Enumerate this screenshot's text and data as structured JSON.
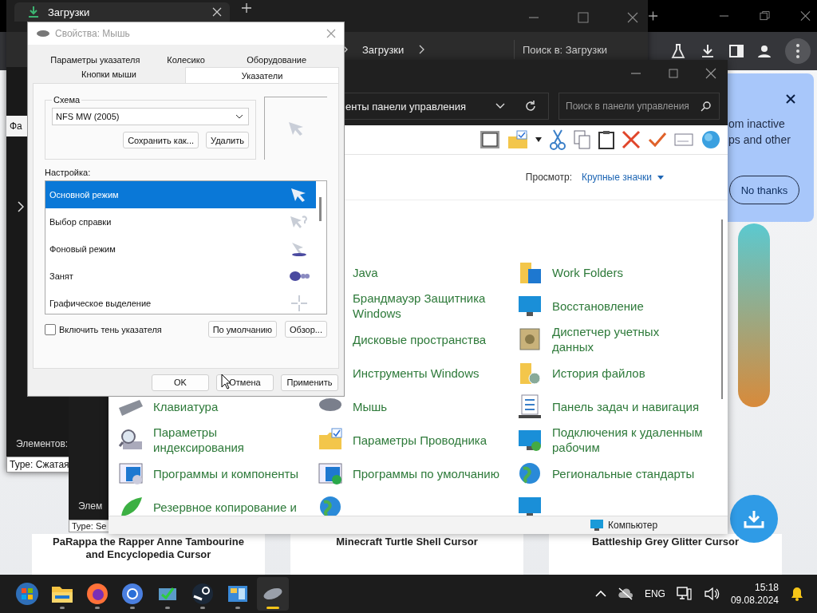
{
  "web_page": {
    "cards": [
      {
        "title": "PaRappa the Rapper Anne Tambourine and Encyclopedia Cursor"
      },
      {
        "title": "Minecraft Turtle Shell Cursor"
      },
      {
        "title": "Battleship Grey Glitter Cursor"
      }
    ]
  },
  "browser": {
    "popup": {
      "lines": [
        "om inactive",
        "ps and other"
      ],
      "button": "No thanks"
    }
  },
  "explorer_window": {
    "tab_title": "Загрузки",
    "breadcrumb": "Загрузки",
    "search_placeholder": "Поиск в: Загрузки",
    "sidebar_text": "Фа",
    "item_count": "Элементов:",
    "tooltip": "Type: Сжатая"
  },
  "explorer_window_2": {
    "item_count": "Элем",
    "tooltip": "Type: Se"
  },
  "control_panel": {
    "address": "енты панели управления",
    "search_placeholder": "Поиск в панели управления",
    "view_label": "Просмотр:",
    "view_value": "Крупные значки",
    "columns": [
      [
        {
          "label": "Клавиатура",
          "kind": "keyboard"
        },
        {
          "label": "Параметры индексирования",
          "kind": "magnifier"
        },
        {
          "label": "Программы и компоненты",
          "kind": "window"
        },
        {
          "label": "Резервное копирование и",
          "kind": "leaf"
        }
      ],
      [
        {
          "label": "Java",
          "kind": "label"
        },
        {
          "label": "Брандмауэр Защитника Windows",
          "kind": "label"
        },
        {
          "label": "Дисковые пространства",
          "kind": "label"
        },
        {
          "label": "Инструменты Windows",
          "kind": "label"
        },
        {
          "label": "Мышь",
          "kind": "mouse"
        },
        {
          "label": "Параметры Проводника",
          "kind": "folder-check"
        },
        {
          "label": "Программы по умолчанию",
          "kind": "window-check"
        },
        {
          "kind": "globe"
        }
      ],
      [
        {
          "label": "Work Folders",
          "kind": "folder-cube"
        },
        {
          "label": "Восстановление",
          "kind": "monitor"
        },
        {
          "label": "Диспетчер учетных данных",
          "kind": "safe"
        },
        {
          "label": "История файлов",
          "kind": "folder-clock"
        },
        {
          "label": "Панель задач и навигация",
          "kind": "list"
        },
        {
          "label": "Подключения к удаленным рабочим",
          "kind": "remote"
        },
        {
          "label": "Региональные стандарты",
          "kind": "globe"
        },
        {
          "kind": "monitor"
        }
      ]
    ],
    "status": "Компьютер"
  },
  "mouse_dialog": {
    "title": "Свойства: Мышь",
    "tab_rows": [
      [
        {
          "label": "Параметры указателя",
          "selected": false
        },
        {
          "label": "Колесико",
          "selected": false
        },
        {
          "label": "Оборудование",
          "selected": false
        }
      ],
      [
        {
          "label": "Кнопки мыши",
          "selected": false
        },
        {
          "label": "Указатели",
          "selected": true
        }
      ]
    ],
    "scheme_label": "Схема",
    "scheme_value": "NFS MW (2005)",
    "scheme_buttons": [
      "Сохранить как...",
      "Удалить"
    ],
    "customize_label": "Настройка:",
    "cursors": [
      {
        "name": "Основной режим",
        "kind": "arrow",
        "selected": true
      },
      {
        "name": "Выбор справки",
        "kind": "help",
        "selected": false
      },
      {
        "name": "Фоновый режим",
        "kind": "working",
        "selected": false
      },
      {
        "name": "Занят",
        "kind": "busy",
        "selected": false
      },
      {
        "name": "Графическое выделение",
        "kind": "cross",
        "selected": false
      }
    ],
    "shadow": {
      "label": "Включить тень указателя",
      "checked": false
    },
    "list_buttons": [
      "По умолчанию",
      "Обзор..."
    ],
    "footer_buttons": [
      "OK",
      "Отмена",
      "Применить"
    ]
  },
  "taskbar": {
    "apps": [
      {
        "kind": "start",
        "running": false,
        "active": false
      },
      {
        "kind": "folder",
        "running": true,
        "active": false
      },
      {
        "kind": "firefox",
        "running": true,
        "active": false
      },
      {
        "kind": "chrome",
        "running": true,
        "active": false
      },
      {
        "kind": "monitor-app",
        "running": true,
        "active": false
      },
      {
        "kind": "steam",
        "running": true,
        "active": false
      },
      {
        "kind": "control-panel",
        "running": true,
        "active": false
      },
      {
        "kind": "mouse",
        "running": true,
        "active": true
      }
    ],
    "language": "ENG",
    "time": "15:18",
    "date": "09.08.2024"
  }
}
